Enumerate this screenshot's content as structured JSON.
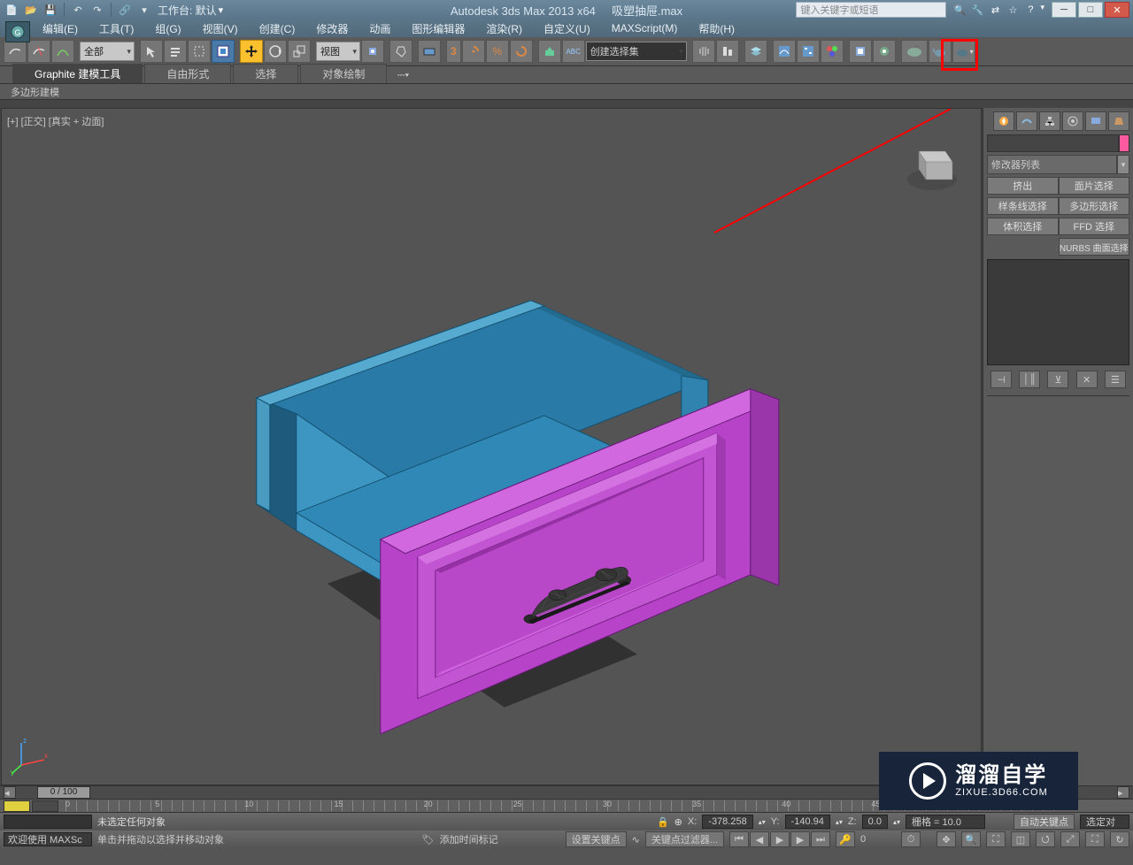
{
  "titlebar": {
    "workspace_label": "工作台: 默认",
    "app_title": "Autodesk 3ds Max  2013 x64",
    "doc_title": "吸塑抽屉.max",
    "search_placeholder": "键入关键字或短语"
  },
  "menubar": {
    "items": [
      "编辑(E)",
      "工具(T)",
      "组(G)",
      "视图(V)",
      "创建(C)",
      "修改器",
      "动画",
      "图形编辑器",
      "渲染(R)",
      "自定义(U)",
      "MAXScript(M)",
      "帮助(H)"
    ]
  },
  "toolbar": {
    "filter_combo": "全部",
    "view_combo": "视图",
    "snap_angle": "3",
    "named_sel": "创建选择集"
  },
  "ribbon": {
    "tabs": [
      "Graphite 建模工具",
      "自由形式",
      "选择",
      "对象绘制"
    ],
    "sub": "多边形建模"
  },
  "viewport": {
    "label": "[+] [正交] [真实 + 边面]"
  },
  "cmdpanel": {
    "modlist_label": "修改器列表",
    "buttons_row1": [
      "挤出",
      "面片选择"
    ],
    "buttons_row2": [
      "样条线选择",
      "多边形选择"
    ],
    "buttons_row3": [
      "体积选择",
      "FFD 选择"
    ],
    "buttons_row4": [
      "",
      "NURBS 曲面选择"
    ]
  },
  "status": {
    "frame": "0 / 100",
    "sel_text": "未选定任何对象",
    "x": "-378.258",
    "y": "-140.94",
    "z": "0.0",
    "grid": "栅格 = 10.0",
    "autokey": "自动关键点",
    "selcombo": "选定对",
    "welcome": "欢迎使用  MAXSc",
    "hint": "单击并拖动以选择并移动对象",
    "addtime": "添加时间标记",
    "setkey": "设置关键点",
    "keyfilter": "关键点过滤器..."
  },
  "watermark": {
    "big": "溜溜自学",
    "small": "ZIXUE.3D66.COM"
  }
}
